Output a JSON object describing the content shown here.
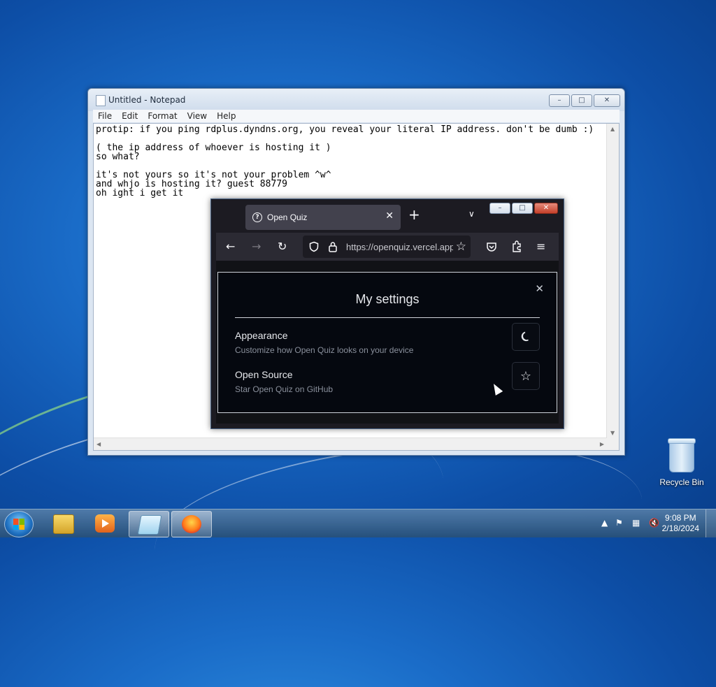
{
  "notepad": {
    "title": "Untitled - Notepad",
    "menu": [
      "File",
      "Edit",
      "Format",
      "View",
      "Help"
    ],
    "content": "protip: if you ping rdplus.dyndns.org, you reveal your literal IP address. don't be dumb :)\n\n( the ip address of whoever is hosting it )\nso what?\n\nit's not yours so it's not your problem ^w^\nand whjo is hosting it? guest 88779\noh ight i get it",
    "buttons": {
      "minimize": "–",
      "maximize": "□",
      "close": "✕"
    }
  },
  "firefox": {
    "tab_title": "Open Quiz",
    "url": "https://openquiz.vercel.app",
    "icons": [
      "back-icon",
      "forward-icon",
      "reload-icon",
      "shield-icon",
      "lock-icon",
      "star-icon",
      "pocket-icon",
      "extensions-icon",
      "menu-icon"
    ]
  },
  "settings": {
    "title": "My settings",
    "items": [
      {
        "title": "Appearance",
        "description": "Customize how Open Quiz looks on your device",
        "icon": "moon-icon"
      },
      {
        "title": "Open Source",
        "description": "Star Open Quiz on GitHub",
        "icon": "star-icon"
      }
    ]
  },
  "desktop": {
    "recycle_bin_label": "Recycle Bin"
  },
  "taskbar": {
    "items": [
      "start-button",
      "windows-explorer",
      "windows-media-player",
      "notepad",
      "firefox"
    ],
    "clock": {
      "time": "9:08 PM",
      "date": "2/18/2024"
    }
  },
  "colors": {
    "desktop_blue": "#1a6cc8",
    "modal_bg": "#05080f",
    "firefox_chrome": "#2b2a33"
  }
}
